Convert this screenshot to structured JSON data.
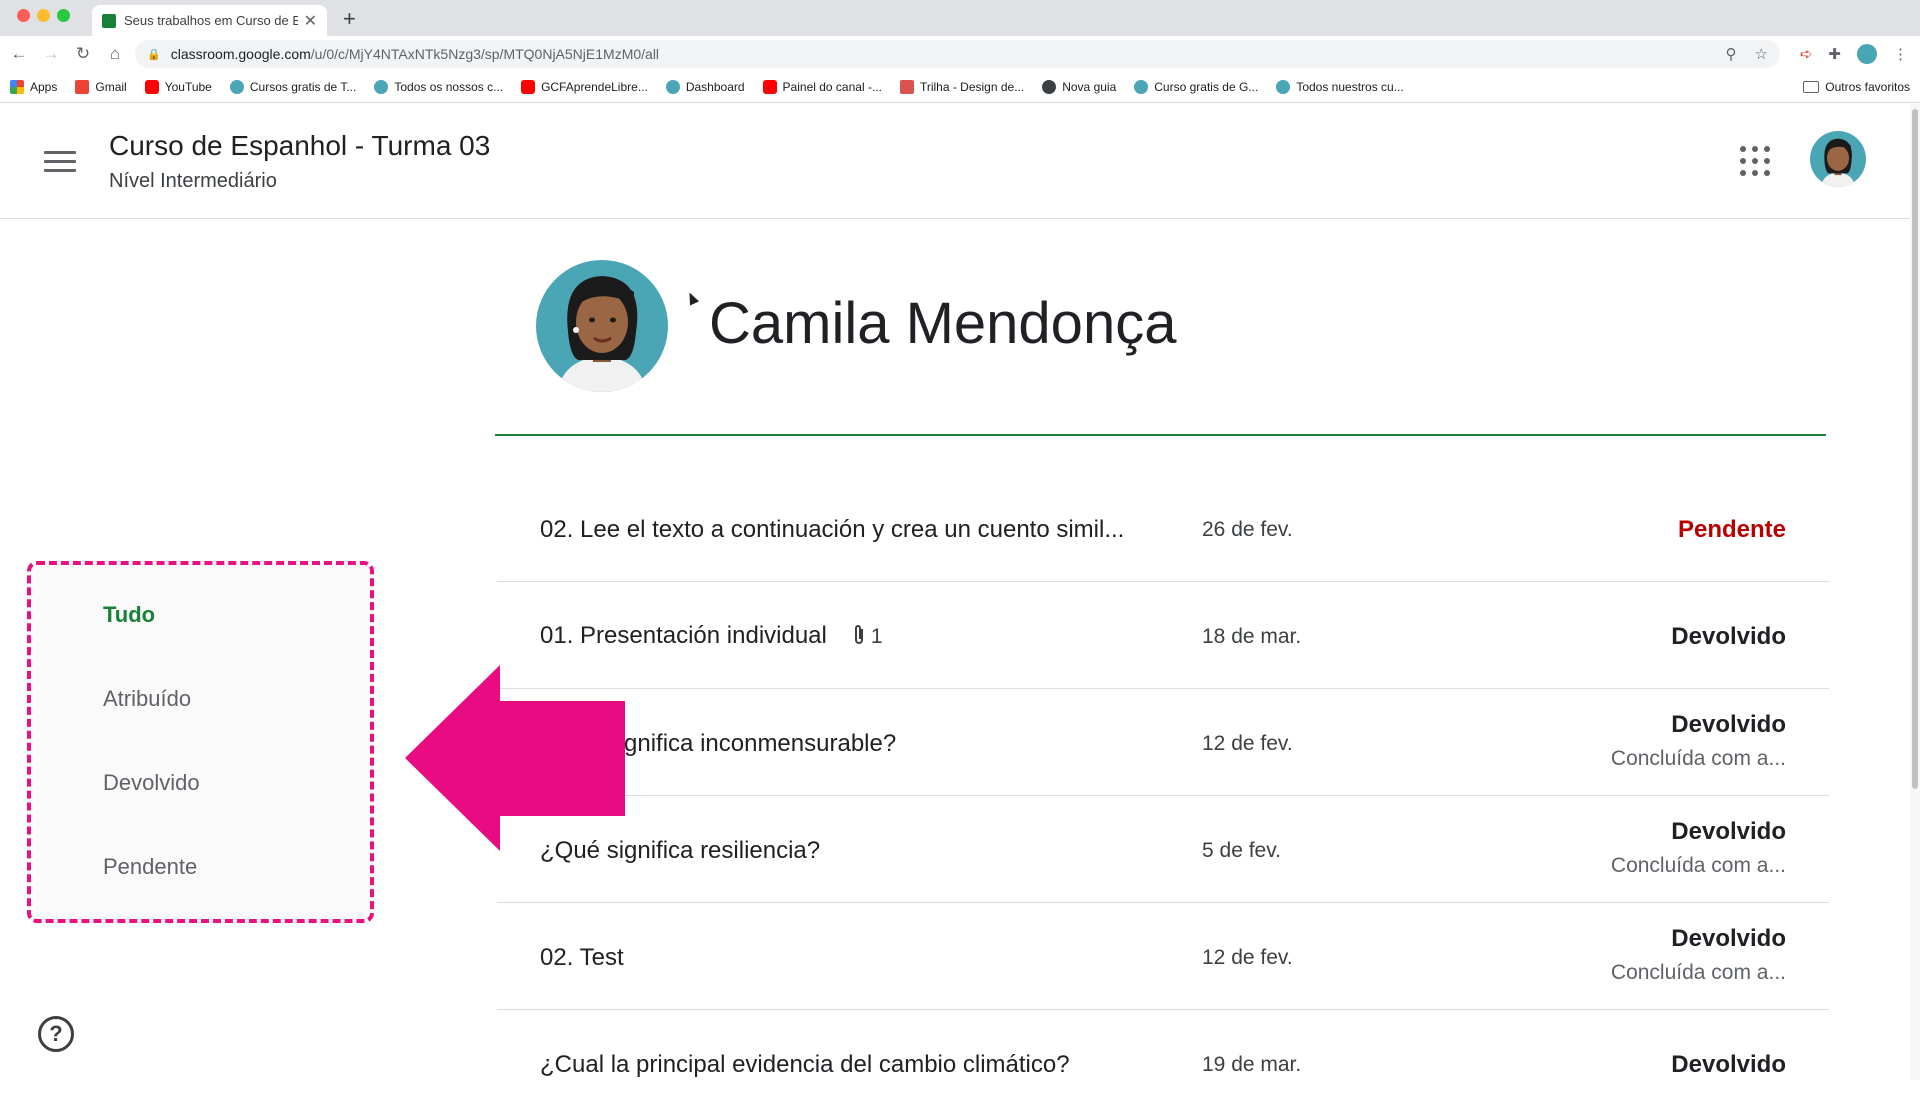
{
  "browser": {
    "tab_title": "Seus trabalhos em Curso de Espanhol",
    "url_domain": "classroom.google.com",
    "url_path": "/u/0/c/MjY4NTAxNTk5Nzg3/sp/MTQ0NjA5NjE1MzM0/all",
    "bookmarks": [
      {
        "label": "Apps",
        "color": "#ea4335"
      },
      {
        "label": "Gmail",
        "color": "#ea4335"
      },
      {
        "label": "YouTube",
        "color": "#ff0000"
      },
      {
        "label": "Cursos gratis de T...",
        "color": "#4aa6b5"
      },
      {
        "label": "Todos os nossos c...",
        "color": "#4aa6b5"
      },
      {
        "label": "GCFAprendeLibre...",
        "color": "#ff0000"
      },
      {
        "label": "Dashboard",
        "color": "#4aa6b5"
      },
      {
        "label": "Painel do canal -...",
        "color": "#ff0000"
      },
      {
        "label": "Trilha - Design de...",
        "color": "#d9534f"
      },
      {
        "label": "Nova guia",
        "color": "#3c4043"
      },
      {
        "label": "Curso gratis de G...",
        "color": "#4aa6b5"
      },
      {
        "label": "Todos nuestros cu...",
        "color": "#4aa6b5"
      }
    ],
    "other_bookmarks": "Outros favoritos"
  },
  "header": {
    "course_title": "Curso de Espanhol - Turma 03",
    "course_subtitle": "Nível Intermediário"
  },
  "student": {
    "name": "Camila Mendonça"
  },
  "filters": {
    "items": [
      {
        "label": "Tudo",
        "active": true
      },
      {
        "label": "Atribuído",
        "active": false
      },
      {
        "label": "Devolvido",
        "active": false
      },
      {
        "label": "Pendente",
        "active": false
      }
    ]
  },
  "assignments": [
    {
      "title": "02. Lee el texto a continuación y crea un cuento simil...",
      "date": "26 de fev.",
      "status": "Pendente",
      "sub": "",
      "attachments": ""
    },
    {
      "title": "01. Presentación individual",
      "date": "18 de mar.",
      "status": "Devolvido",
      "sub": "",
      "attachments": "1"
    },
    {
      "title": "¿Qué significa inconmensurable?",
      "date": "12 de fev.",
      "status": "Devolvido",
      "sub": "Concluída com a...",
      "attachments": ""
    },
    {
      "title": "¿Qué significa resiliencia?",
      "date": "5 de fev.",
      "status": "Devolvido",
      "sub": "Concluída com a...",
      "attachments": ""
    },
    {
      "title": "02. Test",
      "date": "12 de fev.",
      "status": "Devolvido",
      "sub": "Concluída com a...",
      "attachments": ""
    },
    {
      "title": "¿Cual la principal evidencia del cambio climático?",
      "date": "19 de mar.",
      "status": "Devolvido",
      "sub": "",
      "attachments": ""
    }
  ],
  "colors": {
    "accent_green": "#188038",
    "pending_red": "#b80000",
    "highlight_pink": "#e8117f"
  }
}
